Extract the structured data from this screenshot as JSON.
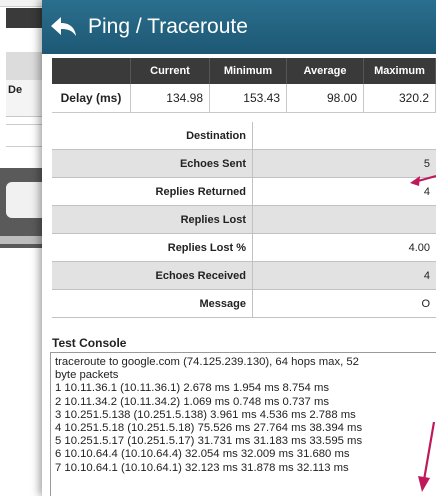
{
  "background_window": {
    "row_label": "De"
  },
  "window": {
    "title": "Ping / Traceroute"
  },
  "stats_table": {
    "headers": [
      "",
      "Current",
      "Minimum",
      "Average",
      "Maximum"
    ],
    "rows": [
      {
        "label": "Delay (ms)",
        "current": "134.98",
        "minimum": "153.43",
        "average": "98.00",
        "maximum": "320.2"
      }
    ]
  },
  "info_table": {
    "rows": [
      {
        "label": "Destination",
        "value": ""
      },
      {
        "label": "Echoes Sent",
        "value": "5"
      },
      {
        "label": "Replies Returned",
        "value": "4"
      },
      {
        "label": "Replies Lost",
        "value": ""
      },
      {
        "label": "Replies Lost %",
        "value": "4.00"
      },
      {
        "label": "Echoes Received",
        "value": "4"
      },
      {
        "label": "Message",
        "value": "O"
      }
    ]
  },
  "console": {
    "title": "Test Console",
    "lines": [
      "traceroute to google.com (74.125.239.130), 64 hops max, 52 byte packets",
      "1  10.11.36.1 (10.11.36.1)  2.678 ms  1.954 ms  8.754 ms",
      "2  10.11.34.2 (10.11.34.2)  1.069 ms  0.748 ms  0.737 ms",
      "3  10.251.5.138 (10.251.5.138)  3.961 ms  4.536 ms  2.788 ms",
      "4  10.251.5.18 (10.251.5.18)  75.526 ms  27.764 ms  38.394 ms",
      "5  10.251.5.17 (10.251.5.17)  31.731 ms  31.183 ms  33.595 ms",
      "6  10.10.64.4 (10.10.64.4)  32.054 ms  32.009 ms  31.680 ms",
      "7  10.10.64.1 (10.10.64.1)  32.123 ms  31.878 ms  32.113 ms"
    ]
  },
  "colors": {
    "titlebar": "#1d5874",
    "table_header": "#3a3a3a",
    "alt_row": "#e2e2e2",
    "annotation_arrow": "#c0185c"
  },
  "icons": {
    "back": "back-arrow-icon",
    "annotation": "pink-arrow-icon"
  }
}
